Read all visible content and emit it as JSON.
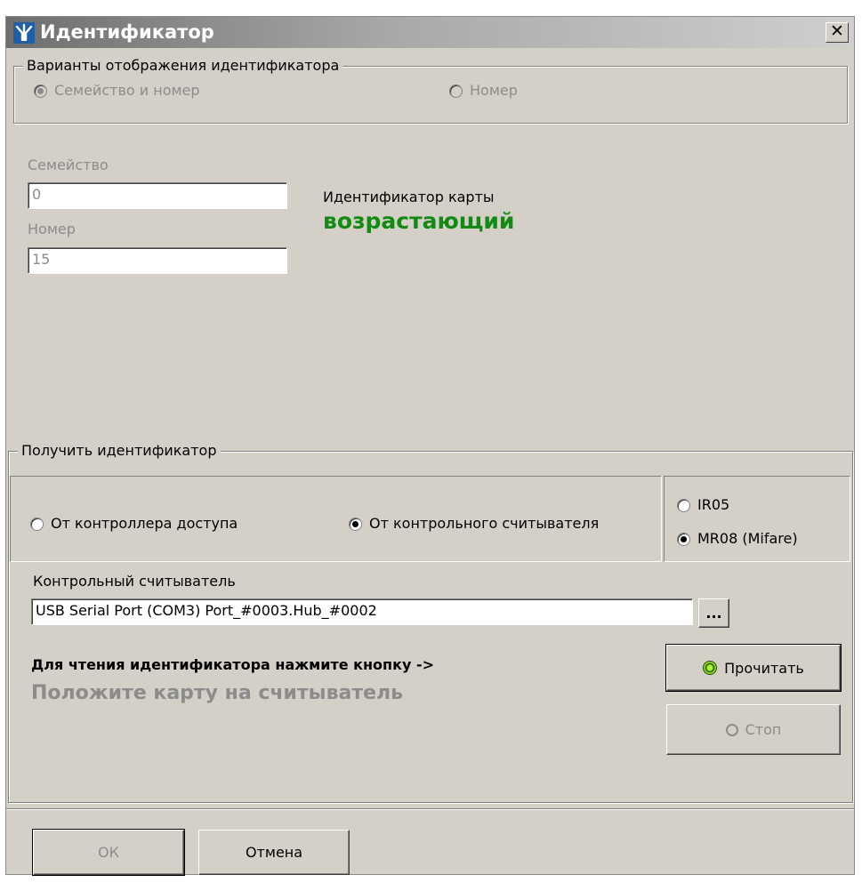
{
  "window": {
    "title": "Идентификатор",
    "close_label": "✕"
  },
  "display_group": {
    "legend": "Варианты отображения идентификатора",
    "radio_family_number": "Семейство и номер",
    "radio_number": "Номер"
  },
  "fields": {
    "family_label": "Семейство",
    "family_value": "0",
    "number_label": "Номер",
    "number_value": "15"
  },
  "card_id": {
    "caption": "Идентификатор карты",
    "status": "возрастающий",
    "status_color": "#138a13"
  },
  "get_group": {
    "legend": "Получить идентификатор",
    "radio_access_controller": "От контроллера доступа",
    "radio_control_reader": "От контрольного считывателя",
    "radio_ir05": "IR05",
    "radio_mr08": "MR08 (Mifare)"
  },
  "reader": {
    "label": "Контрольный считыватель",
    "value": "USB Serial Port (COM3) Port_#0003.Hub_#0002",
    "browse_label": "..."
  },
  "instructions": {
    "line1": "Для чтения идентификатора нажмите кнопку ->",
    "line2": "Положите карту на считыватель"
  },
  "buttons": {
    "read": "Прочитать",
    "stop": "Стоп",
    "ok": "ОК",
    "cancel": "Отмена"
  }
}
